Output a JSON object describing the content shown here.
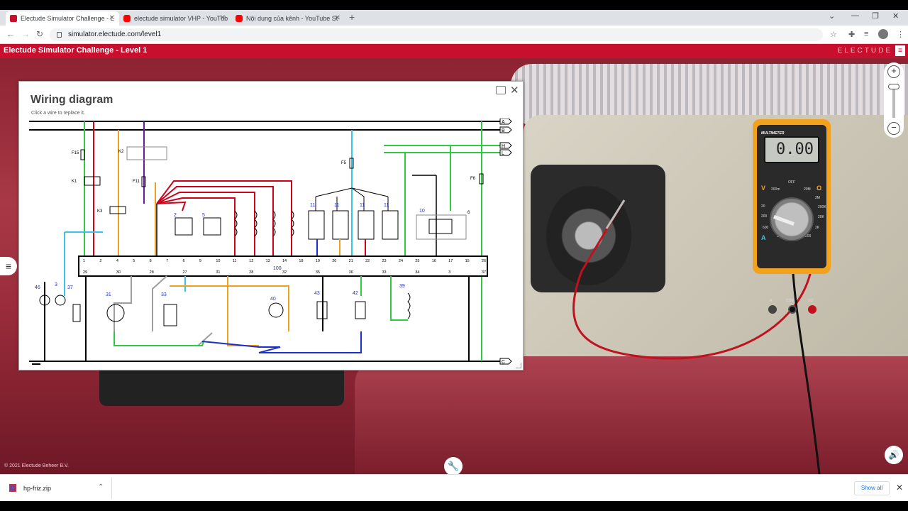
{
  "browser": {
    "tabs": [
      {
        "title": "Electude Simulator Challenge - L",
        "icon": "electude-favicon-icon",
        "active": true
      },
      {
        "title": "electude simulator VHP - YouTub",
        "icon": "youtube-favicon-icon",
        "active": false
      },
      {
        "title": "Nội dung của kênh - YouTube St",
        "icon": "youtube-favicon-icon",
        "active": false
      }
    ],
    "new_tab": "+",
    "url": "simulator.electude.com/level1",
    "window_controls": [
      "minimize-icon",
      "maximize-icon",
      "close-icon"
    ]
  },
  "app": {
    "title": "Electude Simulator Challenge - Level 1",
    "brand": "ELECTUDE",
    "copyright": "© 2021 Electude Beheer B.V."
  },
  "dialog": {
    "title": "Wiring diagram",
    "subtitle": "Click a wire to replace it.",
    "buses_right": [
      "A",
      "B",
      "H",
      "L",
      "C"
    ],
    "fuses": [
      "F15",
      "F11",
      "F5",
      "F6",
      "K1",
      "K2",
      "K3"
    ],
    "connector_label": "100",
    "pins_top": [
      "1",
      "2",
      "4",
      "5",
      "8",
      "7",
      "6",
      "9",
      "10",
      "11",
      "12",
      "13",
      "14",
      "18",
      "19",
      "20",
      "21",
      "22",
      "23",
      "24",
      "25",
      "16",
      "17",
      "15",
      "26"
    ],
    "pins_bottom": [
      "29",
      "30",
      "28",
      "27",
      "31",
      "28",
      "32",
      "35",
      "36",
      "33",
      "34",
      "3",
      "37"
    ],
    "components_top": [
      "2",
      "5",
      "11",
      "11",
      "11",
      "11",
      "10",
      "6"
    ],
    "components_bottom": [
      "46",
      "3",
      "37",
      "31",
      "33",
      "40",
      "43",
      "42",
      "39"
    ]
  },
  "multimeter": {
    "label": "MULTIMETER",
    "display": "0.00",
    "ranges": [
      "OFF",
      "200m",
      "20M",
      "2M",
      "200K",
      "20K",
      "2K",
      "200",
      "10",
      "20",
      "200",
      "600",
      "2"
    ],
    "unit_left": "V",
    "unit_right": "Ω",
    "unit_amp": "A",
    "jacks": [
      "A",
      "COM",
      "VΩ"
    ]
  },
  "download": {
    "filename": "hp-friz.zip",
    "show_all": "Show all"
  },
  "colors": {
    "brand_red": "#c8102e",
    "meter_orange": "#f3a21e",
    "wire_red": "#d0021b",
    "wire_green": "#2ecc40",
    "wire_blue": "#1b2fd0",
    "wire_cyan": "#39c6e6",
    "wire_orange": "#f0a020",
    "wire_purple": "#6a1b9a",
    "wire_gray": "#9e9e9e"
  }
}
